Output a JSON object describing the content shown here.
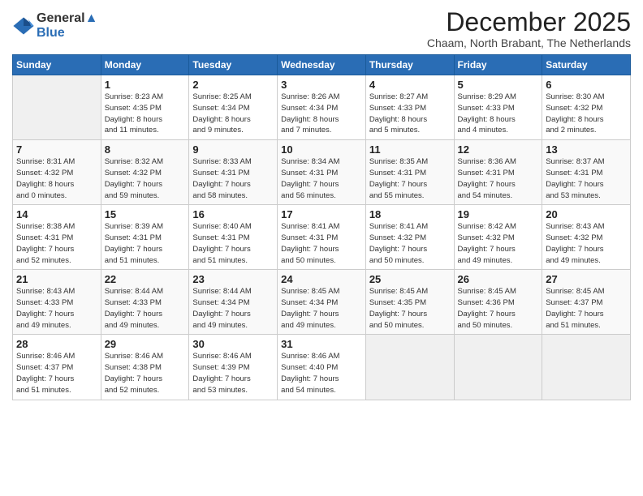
{
  "header": {
    "logo_line1": "General",
    "logo_line2": "Blue",
    "month_title": "December 2025",
    "subtitle": "Chaam, North Brabant, The Netherlands"
  },
  "weekdays": [
    "Sunday",
    "Monday",
    "Tuesday",
    "Wednesday",
    "Thursday",
    "Friday",
    "Saturday"
  ],
  "weeks": [
    [
      {
        "day": "",
        "info": ""
      },
      {
        "day": "1",
        "info": "Sunrise: 8:23 AM\nSunset: 4:35 PM\nDaylight: 8 hours\nand 11 minutes."
      },
      {
        "day": "2",
        "info": "Sunrise: 8:25 AM\nSunset: 4:34 PM\nDaylight: 8 hours\nand 9 minutes."
      },
      {
        "day": "3",
        "info": "Sunrise: 8:26 AM\nSunset: 4:34 PM\nDaylight: 8 hours\nand 7 minutes."
      },
      {
        "day": "4",
        "info": "Sunrise: 8:27 AM\nSunset: 4:33 PM\nDaylight: 8 hours\nand 5 minutes."
      },
      {
        "day": "5",
        "info": "Sunrise: 8:29 AM\nSunset: 4:33 PM\nDaylight: 8 hours\nand 4 minutes."
      },
      {
        "day": "6",
        "info": "Sunrise: 8:30 AM\nSunset: 4:32 PM\nDaylight: 8 hours\nand 2 minutes."
      }
    ],
    [
      {
        "day": "7",
        "info": "Sunrise: 8:31 AM\nSunset: 4:32 PM\nDaylight: 8 hours\nand 0 minutes."
      },
      {
        "day": "8",
        "info": "Sunrise: 8:32 AM\nSunset: 4:32 PM\nDaylight: 7 hours\nand 59 minutes."
      },
      {
        "day": "9",
        "info": "Sunrise: 8:33 AM\nSunset: 4:31 PM\nDaylight: 7 hours\nand 58 minutes."
      },
      {
        "day": "10",
        "info": "Sunrise: 8:34 AM\nSunset: 4:31 PM\nDaylight: 7 hours\nand 56 minutes."
      },
      {
        "day": "11",
        "info": "Sunrise: 8:35 AM\nSunset: 4:31 PM\nDaylight: 7 hours\nand 55 minutes."
      },
      {
        "day": "12",
        "info": "Sunrise: 8:36 AM\nSunset: 4:31 PM\nDaylight: 7 hours\nand 54 minutes."
      },
      {
        "day": "13",
        "info": "Sunrise: 8:37 AM\nSunset: 4:31 PM\nDaylight: 7 hours\nand 53 minutes."
      }
    ],
    [
      {
        "day": "14",
        "info": "Sunrise: 8:38 AM\nSunset: 4:31 PM\nDaylight: 7 hours\nand 52 minutes."
      },
      {
        "day": "15",
        "info": "Sunrise: 8:39 AM\nSunset: 4:31 PM\nDaylight: 7 hours\nand 51 minutes."
      },
      {
        "day": "16",
        "info": "Sunrise: 8:40 AM\nSunset: 4:31 PM\nDaylight: 7 hours\nand 51 minutes."
      },
      {
        "day": "17",
        "info": "Sunrise: 8:41 AM\nSunset: 4:31 PM\nDaylight: 7 hours\nand 50 minutes."
      },
      {
        "day": "18",
        "info": "Sunrise: 8:41 AM\nSunset: 4:32 PM\nDaylight: 7 hours\nand 50 minutes."
      },
      {
        "day": "19",
        "info": "Sunrise: 8:42 AM\nSunset: 4:32 PM\nDaylight: 7 hours\nand 49 minutes."
      },
      {
        "day": "20",
        "info": "Sunrise: 8:43 AM\nSunset: 4:32 PM\nDaylight: 7 hours\nand 49 minutes."
      }
    ],
    [
      {
        "day": "21",
        "info": "Sunrise: 8:43 AM\nSunset: 4:33 PM\nDaylight: 7 hours\nand 49 minutes."
      },
      {
        "day": "22",
        "info": "Sunrise: 8:44 AM\nSunset: 4:33 PM\nDaylight: 7 hours\nand 49 minutes."
      },
      {
        "day": "23",
        "info": "Sunrise: 8:44 AM\nSunset: 4:34 PM\nDaylight: 7 hours\nand 49 minutes."
      },
      {
        "day": "24",
        "info": "Sunrise: 8:45 AM\nSunset: 4:34 PM\nDaylight: 7 hours\nand 49 minutes."
      },
      {
        "day": "25",
        "info": "Sunrise: 8:45 AM\nSunset: 4:35 PM\nDaylight: 7 hours\nand 50 minutes."
      },
      {
        "day": "26",
        "info": "Sunrise: 8:45 AM\nSunset: 4:36 PM\nDaylight: 7 hours\nand 50 minutes."
      },
      {
        "day": "27",
        "info": "Sunrise: 8:45 AM\nSunset: 4:37 PM\nDaylight: 7 hours\nand 51 minutes."
      }
    ],
    [
      {
        "day": "28",
        "info": "Sunrise: 8:46 AM\nSunset: 4:37 PM\nDaylight: 7 hours\nand 51 minutes."
      },
      {
        "day": "29",
        "info": "Sunrise: 8:46 AM\nSunset: 4:38 PM\nDaylight: 7 hours\nand 52 minutes."
      },
      {
        "day": "30",
        "info": "Sunrise: 8:46 AM\nSunset: 4:39 PM\nDaylight: 7 hours\nand 53 minutes."
      },
      {
        "day": "31",
        "info": "Sunrise: 8:46 AM\nSunset: 4:40 PM\nDaylight: 7 hours\nand 54 minutes."
      },
      {
        "day": "",
        "info": ""
      },
      {
        "day": "",
        "info": ""
      },
      {
        "day": "",
        "info": ""
      }
    ]
  ]
}
